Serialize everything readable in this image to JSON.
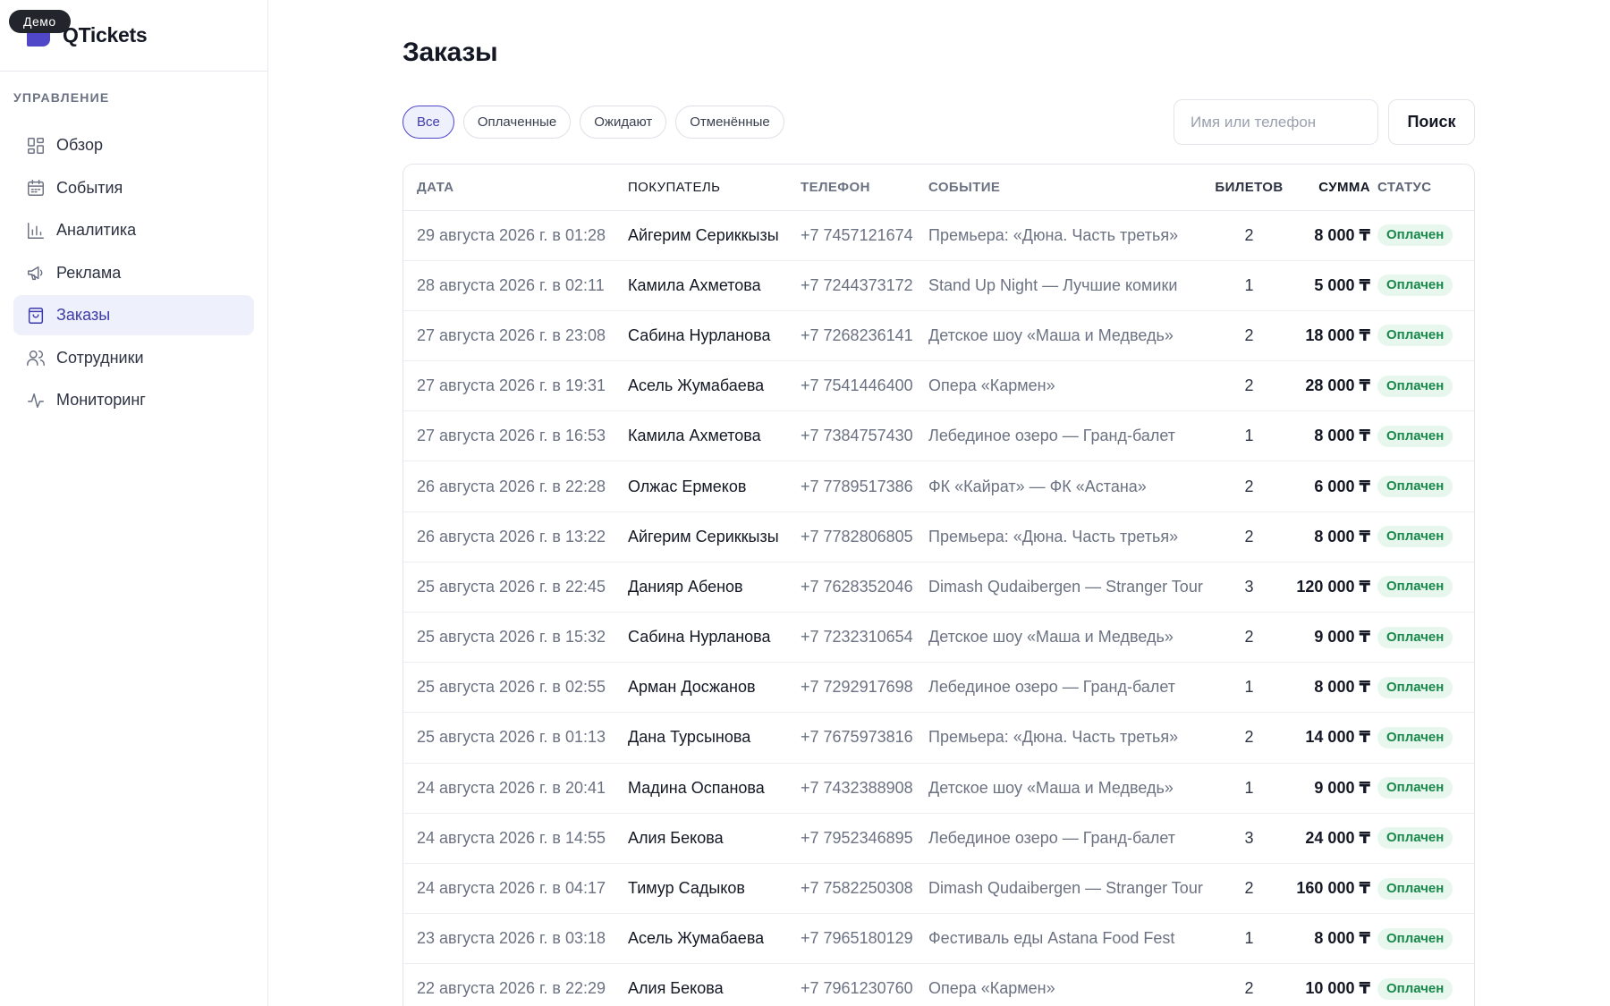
{
  "brand": {
    "name": "QTickets",
    "demo_badge": "Демо"
  },
  "sidebar": {
    "section_title": "УПРАВЛЕНИЕ",
    "items": [
      {
        "label": "Обзор",
        "icon": "dashboard-icon",
        "active": false
      },
      {
        "label": "События",
        "icon": "calendar-icon",
        "active": false
      },
      {
        "label": "Аналитика",
        "icon": "bar-chart-icon",
        "active": false
      },
      {
        "label": "Реклама",
        "icon": "megaphone-icon",
        "active": false
      },
      {
        "label": "Заказы",
        "icon": "shopping-bag-icon",
        "active": true
      },
      {
        "label": "Сотрудники",
        "icon": "users-icon",
        "active": false
      },
      {
        "label": "Мониторинг",
        "icon": "activity-icon",
        "active": false
      }
    ]
  },
  "main": {
    "title": "Заказы",
    "filters": [
      {
        "label": "Все",
        "active": true
      },
      {
        "label": "Оплаченные",
        "active": false
      },
      {
        "label": "Ожидают",
        "active": false
      },
      {
        "label": "Отменённые",
        "active": false
      }
    ],
    "search": {
      "placeholder": "Имя или телефон",
      "value": "",
      "button_label": "Поиск"
    },
    "table": {
      "columns": [
        "ДАТА",
        "ПОКУПАТЕЛЬ",
        "ТЕЛЕФОН",
        "СОБЫТИЕ",
        "БИЛЕТОВ",
        "СУММА",
        "СТАТУС"
      ],
      "rows": [
        {
          "date": "29 августа 2026 г. в 01:28",
          "buyer": "Айгерим Сериккызы",
          "phone": "+7 7457121674",
          "event": "Премьера: «Дюна. Часть третья»",
          "tickets": "2",
          "sum": "8 000 ₸",
          "status": "Оплачен"
        },
        {
          "date": "28 августа 2026 г. в 02:11",
          "buyer": "Камила Ахметова",
          "phone": "+7 7244373172",
          "event": "Stand Up Night — Лучшие комики",
          "tickets": "1",
          "sum": "5 000 ₸",
          "status": "Оплачен"
        },
        {
          "date": "27 августа 2026 г. в 23:08",
          "buyer": "Сабина Нурланова",
          "phone": "+7 7268236141",
          "event": "Детское шоу «Маша и Медведь»",
          "tickets": "2",
          "sum": "18 000 ₸",
          "status": "Оплачен"
        },
        {
          "date": "27 августа 2026 г. в 19:31",
          "buyer": "Асель Жумабаева",
          "phone": "+7 7541446400",
          "event": "Опера «Кармен»",
          "tickets": "2",
          "sum": "28 000 ₸",
          "status": "Оплачен"
        },
        {
          "date": "27 августа 2026 г. в 16:53",
          "buyer": "Камила Ахметова",
          "phone": "+7 7384757430",
          "event": "Лебединое озеро — Гранд-балет",
          "tickets": "1",
          "sum": "8 000 ₸",
          "status": "Оплачен"
        },
        {
          "date": "26 августа 2026 г. в 22:28",
          "buyer": "Олжас Ермеков",
          "phone": "+7 7789517386",
          "event": "ФК «Кайрат» — ФК «Астана»",
          "tickets": "2",
          "sum": "6 000 ₸",
          "status": "Оплачен"
        },
        {
          "date": "26 августа 2026 г. в 13:22",
          "buyer": "Айгерим Сериккызы",
          "phone": "+7 7782806805",
          "event": "Премьера: «Дюна. Часть третья»",
          "tickets": "2",
          "sum": "8 000 ₸",
          "status": "Оплачен"
        },
        {
          "date": "25 августа 2026 г. в 22:45",
          "buyer": "Данияр Абенов",
          "phone": "+7 7628352046",
          "event": "Dimash Qudaibergen — Stranger Tour",
          "tickets": "3",
          "sum": "120 000 ₸",
          "status": "Оплачен"
        },
        {
          "date": "25 августа 2026 г. в 15:32",
          "buyer": "Сабина Нурланова",
          "phone": "+7 7232310654",
          "event": "Детское шоу «Маша и Медведь»",
          "tickets": "2",
          "sum": "9 000 ₸",
          "status": "Оплачен"
        },
        {
          "date": "25 августа 2026 г. в 02:55",
          "buyer": "Арман Досжанов",
          "phone": "+7 7292917698",
          "event": "Лебединое озеро — Гранд-балет",
          "tickets": "1",
          "sum": "8 000 ₸",
          "status": "Оплачен"
        },
        {
          "date": "25 августа 2026 г. в 01:13",
          "buyer": "Дана Турсынова",
          "phone": "+7 7675973816",
          "event": "Премьера: «Дюна. Часть третья»",
          "tickets": "2",
          "sum": "14 000 ₸",
          "status": "Оплачен"
        },
        {
          "date": "24 августа 2026 г. в 20:41",
          "buyer": "Мадина Оспанова",
          "phone": "+7 7432388908",
          "event": "Детское шоу «Маша и Медведь»",
          "tickets": "1",
          "sum": "9 000 ₸",
          "status": "Оплачен"
        },
        {
          "date": "24 августа 2026 г. в 14:55",
          "buyer": "Алия Бекова",
          "phone": "+7 7952346895",
          "event": "Лебединое озеро — Гранд-балет",
          "tickets": "3",
          "sum": "24 000 ₸",
          "status": "Оплачен"
        },
        {
          "date": "24 августа 2026 г. в 04:17",
          "buyer": "Тимур Садыков",
          "phone": "+7 7582250308",
          "event": "Dimash Qudaibergen — Stranger Tour",
          "tickets": "2",
          "sum": "160 000 ₸",
          "status": "Оплачен"
        },
        {
          "date": "23 августа 2026 г. в 03:18",
          "buyer": "Асель Жумабаева",
          "phone": "+7 7965180129",
          "event": "Фестиваль еды Astana Food Fest",
          "tickets": "1",
          "sum": "8 000 ₸",
          "status": "Оплачен"
        },
        {
          "date": "22 августа 2026 г. в 22:29",
          "buyer": "Алия Бекова",
          "phone": "+7 7961230760",
          "event": "Опера «Кармен»",
          "tickets": "2",
          "sum": "10 000 ₸",
          "status": "Оплачен"
        }
      ]
    }
  },
  "colors": {
    "accent": "#4f46c8",
    "accent_bg": "#eef0fc",
    "status_paid_bg": "#e8f7ee",
    "status_paid_text": "#18894a"
  }
}
